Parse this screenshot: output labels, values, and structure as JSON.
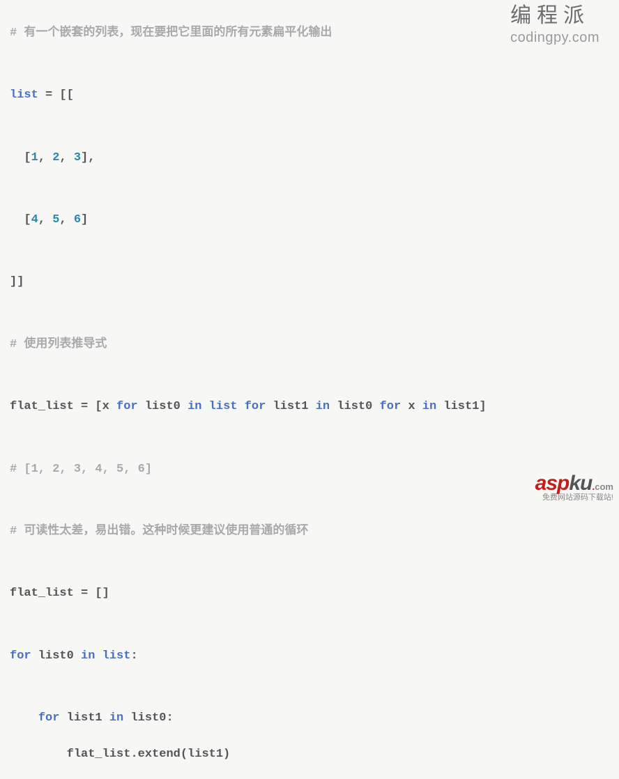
{
  "watermark_top": {
    "cn": "编程派",
    "en": "codingpy.com"
  },
  "watermark_bottom": {
    "asp": "asp",
    "ku": "ku",
    "dot": ".",
    "com": "com",
    "tag": "免费网站源码下载站!"
  },
  "code": {
    "c1": "# 有一个嵌套的列表，现在要把它里面的所有元素扁平化输出",
    "l1_kw": "list",
    "l1_rest": " = [[",
    "row1_open": "  [",
    "row1_n1": "1",
    "row1_c1": ", ",
    "row1_n2": "2",
    "row1_c2": ", ",
    "row1_n3": "3",
    "row1_close": "],",
    "row2_open": "  [",
    "row2_n1": "4",
    "row2_c1": ", ",
    "row2_n2": "5",
    "row2_c2": ", ",
    "row2_n3": "6",
    "row2_close": "]",
    "close_outer": "]]",
    "c2": "# 使用列表推导式",
    "flat_assign1": "flat_list = [x ",
    "for1": "for",
    "mid1": " list0 ",
    "in1": "in",
    "mid2": " ",
    "list_kw1": "list",
    "sp1": " ",
    "for2": "for",
    "mid3": " list1 ",
    "in2": "in",
    "mid4": " list0 ",
    "for3": "for",
    "mid5": " x ",
    "in3": "in",
    "mid6": " list1]",
    "c3": "# [1, 2, 3, 4, 5, 6]",
    "c4": "# 可读性太差，易出错。这种时候更建议使用普通的循环",
    "flat_assign2": "flat_list = []",
    "outer_for": "for",
    "outer_mid1": " list0 ",
    "outer_in": "in",
    "outer_sp": " ",
    "outer_list": "list",
    "outer_colon": ":",
    "inner_indent": "    ",
    "inner_for": "for",
    "inner_mid1": " list1 ",
    "inner_in": "in",
    "inner_mid2": " list0:",
    "extend_indent": "        ",
    "extend_call": "flat_list.extend(list1)"
  }
}
